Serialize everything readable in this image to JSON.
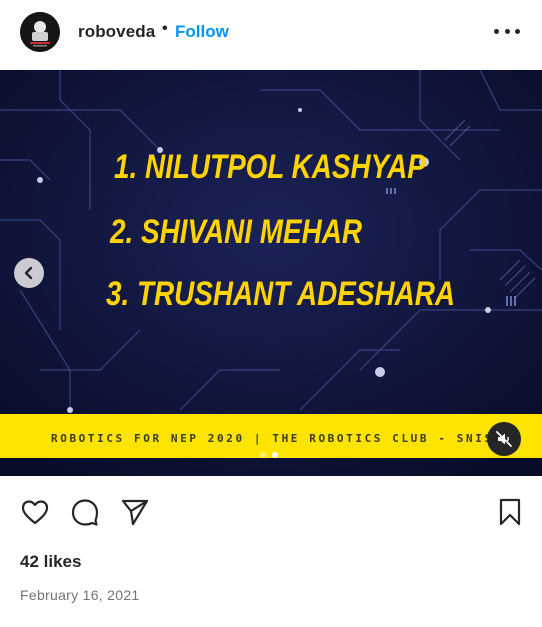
{
  "post": {
    "username": "roboveda",
    "separator": "•",
    "follow_label": "Follow",
    "more_icon": "more-horizontal-icon"
  },
  "media": {
    "names": [
      "1. NILUTPOL KASHYAP",
      "2. SHIVANI MEHAR",
      "3. TRUSHANT ADESHARA"
    ],
    "banner": "ROBOTICS FOR NEP 2020 | THE ROBOTICS CLUB - SNIST",
    "colors": {
      "background": "#0d1034",
      "text": "#ffd400",
      "banner": "#fde400"
    },
    "carousel": {
      "total": 2,
      "current": 2
    },
    "prev_icon": "chevron-left-icon",
    "mute_icon": "volume-muted-icon"
  },
  "actions": {
    "like_icon": "heart-icon",
    "comment_icon": "comment-icon",
    "share_icon": "send-icon",
    "save_icon": "bookmark-icon"
  },
  "likes": "42 likes",
  "date": "February 16, 2021"
}
